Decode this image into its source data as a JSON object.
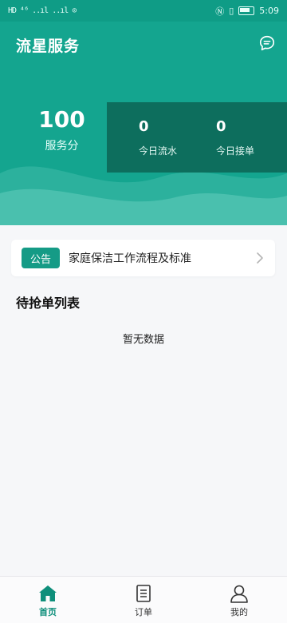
{
  "status_bar": {
    "left_text": "HD ⁴⁶ ..ıl ..ıl ⊙",
    "time": "5:09"
  },
  "header": {
    "title": "流星服务",
    "message_icon": "chat-icon"
  },
  "stats": {
    "score_value": "100",
    "score_label": "服务分",
    "today_flow_value": "0",
    "today_flow_label": "今日流水",
    "today_orders_value": "0",
    "today_orders_label": "今日接单"
  },
  "notice": {
    "tag": "公告",
    "text": "家庭保洁工作流程及标准"
  },
  "list": {
    "title": "待抢单列表",
    "empty_text": "暂无数据"
  },
  "tabbar": {
    "items": [
      {
        "label": "首页",
        "icon": "home-icon",
        "active": true
      },
      {
        "label": "订单",
        "icon": "order-icon",
        "active": false
      },
      {
        "label": "我的",
        "icon": "user-icon",
        "active": false
      }
    ]
  },
  "colors": {
    "primary": "#14a58f",
    "dark_panel": "#0d6e5d",
    "tag": "#159b86"
  }
}
